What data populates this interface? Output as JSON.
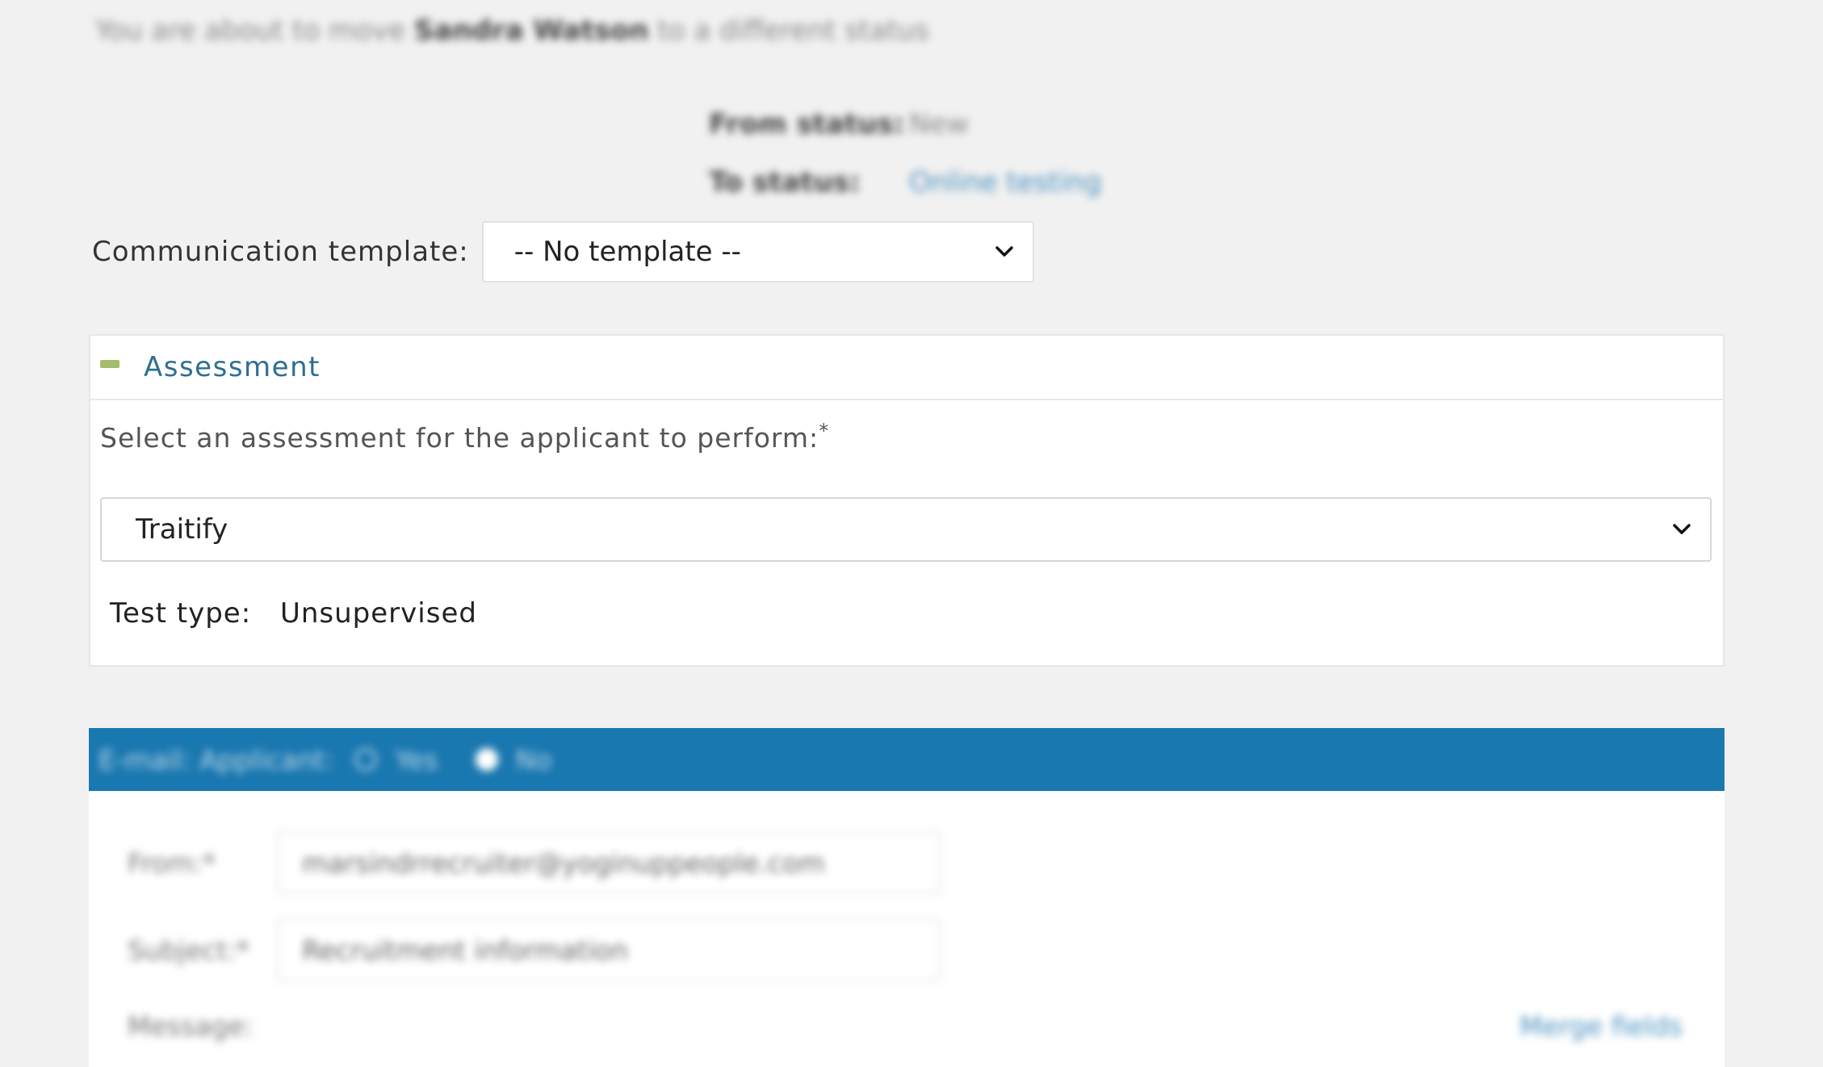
{
  "intro": {
    "prefix": "You are about to move",
    "applicant": "Sandra Watson",
    "suffix": "to a different status"
  },
  "status": {
    "from_label": "From status:",
    "from_value": "New",
    "to_label": "To status:",
    "to_value": "Online testing"
  },
  "communication": {
    "label": "Communication template:",
    "selected": "-- No template --"
  },
  "assessment": {
    "title": "Assessment",
    "prompt": "Select an assessment for the applicant to perform:",
    "required_mark": "*",
    "selected": "Traitify",
    "test_type_label": "Test type:",
    "test_type_value": "Unsupervised"
  },
  "email": {
    "label": "E-mail: Applicant:",
    "yes_label": "Yes",
    "no_label": "No",
    "selected": "No",
    "from_label": "From:*",
    "from_value": "marsindrrecruiter@yoginuppeople.com",
    "subject_label": "Subject:*",
    "subject_value": "Recruitment information",
    "message_label": "Message:",
    "merge_fields": "Merge fields"
  },
  "colors": {
    "accent": "#1a78b0",
    "panel_title": "#2e6f8f",
    "collapse_icon": "#a5bd6a",
    "background": "#f1f1f1"
  },
  "icons": {
    "collapse": "minus-icon",
    "dropdown": "chevron-down-icon"
  }
}
